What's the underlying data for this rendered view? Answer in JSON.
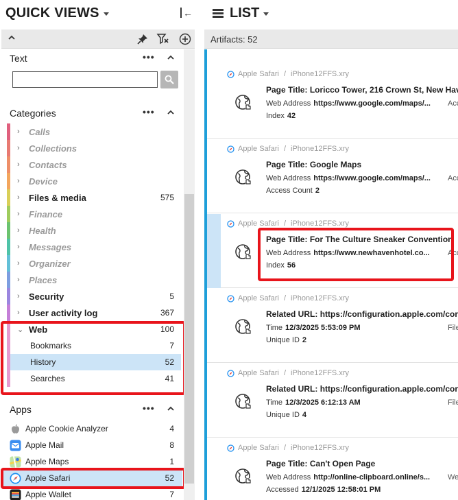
{
  "quick_views": {
    "title": "QUICK VIEWS",
    "text_section": {
      "title": "Text",
      "dots": "•••",
      "search_value": "",
      "search_placeholder": ""
    },
    "categories_section": {
      "title": "Categories",
      "dots": "•••",
      "items": [
        {
          "label": "Calls",
          "count": "",
          "style": "dim",
          "color": "#e0607e"
        },
        {
          "label": "Collections",
          "count": "",
          "style": "dim",
          "color": "#e87a72"
        },
        {
          "label": "Contacts",
          "count": "",
          "style": "dim",
          "color": "#ee8f68"
        },
        {
          "label": "Device",
          "count": "",
          "style": "dim",
          "color": "#f3a65d"
        },
        {
          "label": "Files & media",
          "count": "575",
          "style": "bold",
          "color": "#d9cf58"
        },
        {
          "label": "Finance",
          "count": "",
          "style": "dim",
          "color": "#9fcc5d"
        },
        {
          "label": "Health",
          "count": "",
          "style": "dim",
          "color": "#6cc36f"
        },
        {
          "label": "Messages",
          "count": "",
          "style": "dim",
          "color": "#4fc3a8"
        },
        {
          "label": "Organizer",
          "count": "",
          "style": "dim",
          "color": "#63c0d8"
        },
        {
          "label": "Places",
          "count": "",
          "style": "dim",
          "color": "#7d9ee0"
        },
        {
          "label": "Security",
          "count": "5",
          "style": "bold",
          "color": "#9b86df"
        },
        {
          "label": "User activity log",
          "count": "367",
          "style": "bold",
          "color": "#c57fd8"
        },
        {
          "label": "Web",
          "count": "100",
          "style": "bold",
          "color": "#e59ad0"
        }
      ],
      "web_children": [
        {
          "label": "Bookmarks",
          "count": "7",
          "selected": false
        },
        {
          "label": "History",
          "count": "52",
          "selected": true
        },
        {
          "label": "Searches",
          "count": "41",
          "selected": false
        }
      ]
    },
    "apps_section": {
      "title": "Apps",
      "dots": "•••",
      "items": [
        {
          "label": "Apple Cookie Analyzer",
          "count": "4",
          "icon": "apple-logo-icon",
          "selected": false
        },
        {
          "label": "Apple Mail",
          "count": "8",
          "icon": "mail-icon",
          "selected": false
        },
        {
          "label": "Apple Maps",
          "count": "1",
          "icon": "maps-icon",
          "selected": false
        },
        {
          "label": "Apple Safari",
          "count": "52",
          "icon": "safari-icon",
          "selected": true
        },
        {
          "label": "Apple Wallet",
          "count": "7",
          "icon": "wallet-icon",
          "selected": false
        }
      ]
    }
  },
  "list": {
    "title": "LIST",
    "artifacts_label": "Artifacts: 52",
    "cards": [
      {
        "app": "Apple Safari",
        "source": "iPhone12FFS.xry",
        "title_label": "Page Title:",
        "title_value": "Loricco Tower, 216 Crown St, New Hav",
        "l2_label": "Web Address",
        "l2_value": "https://www.google.com/maps/...",
        "l2_extra": "Acc",
        "l3_label": "Index",
        "l3_value": "42",
        "selected": false
      },
      {
        "app": "Apple Safari",
        "source": "iPhone12FFS.xry",
        "title_label": "Page Title:",
        "title_value": "Google Maps",
        "l2_label": "Web Address",
        "l2_value": "https://www.google.com/maps/...",
        "l2_extra": "Acc",
        "l3_label": "Access Count",
        "l3_value": "2",
        "selected": false
      },
      {
        "app": "Apple Safari",
        "source": "iPhone12FFS.xry",
        "title_label": "Page Title:",
        "title_value": "For The Culture Sneaker Convention",
        "l2_label": "Web Address",
        "l2_value": "https://www.newhavenhotel.co...",
        "l2_extra": "Acc",
        "l3_label": "Index",
        "l3_value": "56",
        "selected": true
      },
      {
        "app": "Apple Safari",
        "source": "iPhone12FFS.xry",
        "title_label": "Related URL:",
        "title_value": "https://configuration.apple.com/cor",
        "l2_label": "Time",
        "l2_value": "12/3/2025 5:53:09 PM",
        "l2_extra": "File",
        "l3_label": "Unique ID",
        "l3_value": "2",
        "selected": false
      },
      {
        "app": "Apple Safari",
        "source": "iPhone12FFS.xry",
        "title_label": "Related URL:",
        "title_value": "https://configuration.apple.com/cor",
        "l2_label": "Time",
        "l2_value": "12/3/2025 6:12:13 AM",
        "l2_extra": "File",
        "l3_label": "Unique ID",
        "l3_value": "4",
        "selected": false
      },
      {
        "app": "Apple Safari",
        "source": "iPhone12FFS.xry",
        "title_label": "Page Title:",
        "title_value": "Can't Open Page",
        "l2_label": "Web Address",
        "l2_value": "http://online-clipboard.online/s...",
        "l2_extra": "We",
        "l3_label": "Accessed",
        "l3_value": "12/1/2025 12:58:01 PM",
        "selected": false
      }
    ]
  },
  "colors": {
    "accent": "#1e9fd9",
    "selection": "#cce4f7",
    "highlight_box": "#e8141b"
  }
}
